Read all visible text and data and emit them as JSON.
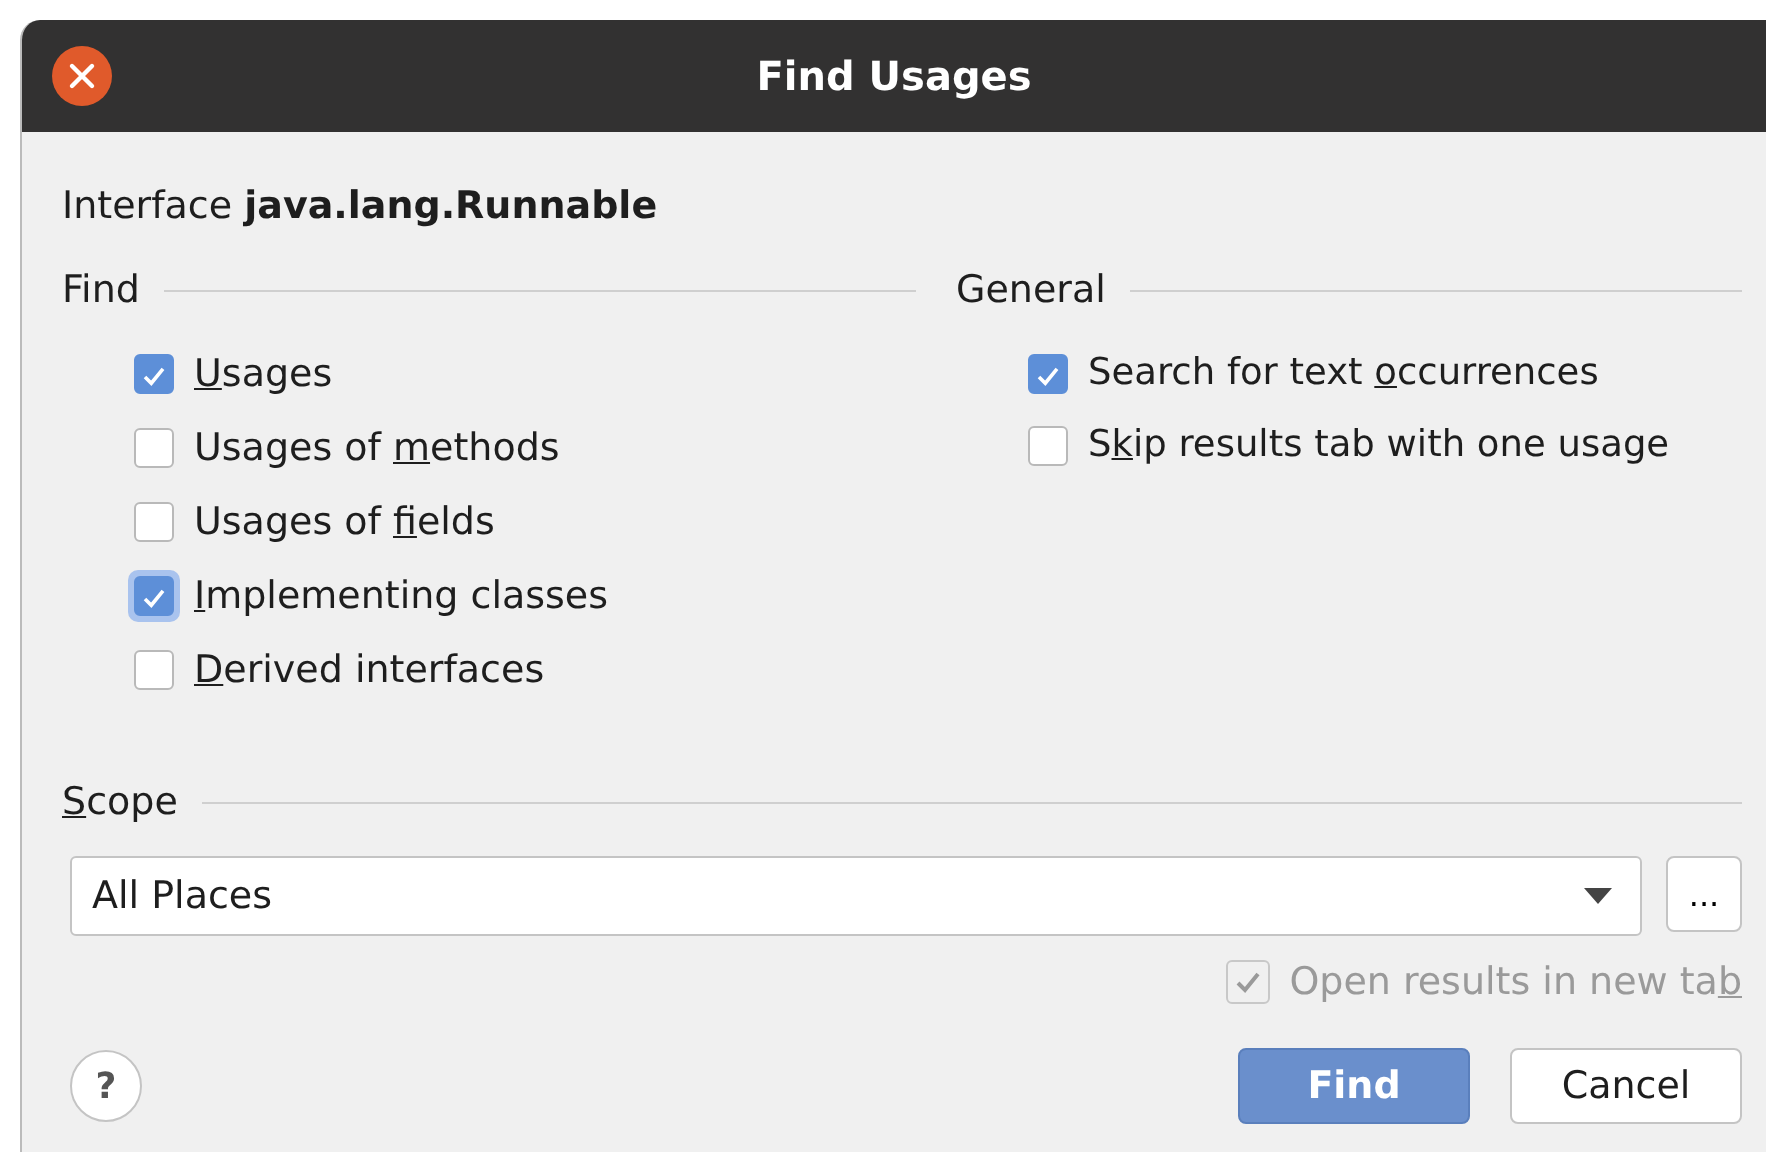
{
  "window": {
    "title": "Find Usages"
  },
  "subject": "Interface **java.lang.Runnable**",
  "find": {
    "title": "Find",
    "options": [
      {
        "label": {
          "key": "U",
          "post": "sages"
        },
        "checked": true,
        "focused": false
      },
      {
        "label": {
          "pre": "Usages of ",
          "key": "m",
          "post": "ethods"
        },
        "checked": false,
        "focused": false
      },
      {
        "label": {
          "pre": "Usages of ",
          "key": "f",
          "post": "ields"
        },
        "checked": false,
        "focused": false
      },
      {
        "label": {
          "key": "I",
          "post": "mplementing classes"
        },
        "checked": true,
        "focused": true
      },
      {
        "label": {
          "key": "D",
          "post": "erived interfaces"
        },
        "checked": false,
        "focused": false
      }
    ]
  },
  "general": {
    "title": "General",
    "options": [
      {
        "label": {
          "pre": "Search for text ",
          "key": "o",
          "post": "ccurrences"
        },
        "checked": true,
        "focused": false
      },
      {
        "label": {
          "pre": "S",
          "key": "k",
          "post": "ip results tab with one usage"
        },
        "checked": false,
        "focused": false
      }
    ]
  },
  "scope": {
    "title": {
      "key": "S",
      "post": "cope"
    },
    "value": "All Places",
    "more": "...",
    "open_in_new_tab": {
      "label": {
        "pre": "Open results in new ta",
        "key": "b"
      },
      "checked": true,
      "disabled": true
    }
  },
  "buttons": [
    {
      "label": "Find",
      "kind": "primary"
    },
    {
      "label": "Cancel",
      "kind": "secondary"
    }
  ],
  "help": "?"
}
